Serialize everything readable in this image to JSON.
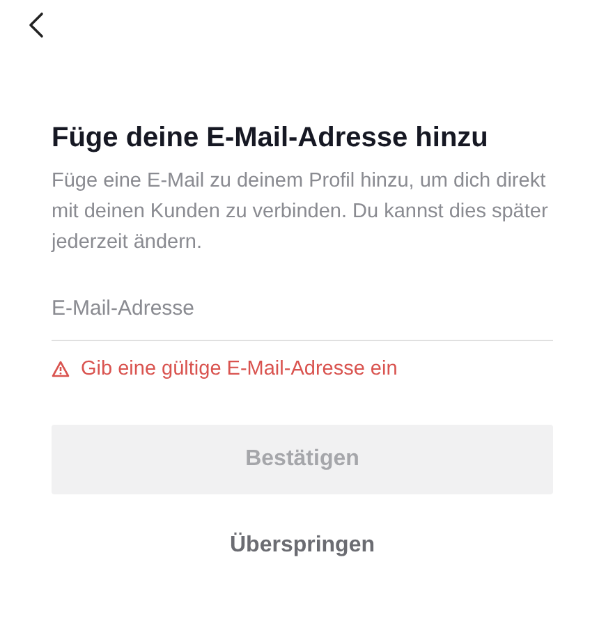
{
  "title": "Füge deine E-Mail-Adresse hinzu",
  "description": "Füge eine E-Mail zu deinem Profil hinzu, um dich direkt mit deinen Kunden zu verbinden. Du kannst dies später jederzeit ändern.",
  "email_field": {
    "placeholder": "E-Mail-Adresse"
  },
  "error": "Gib eine gültige E-Mail-Adresse ein",
  "confirm_button": {
    "label": "Bestätigen",
    "disabled": true
  },
  "skip_link": "Überspringen"
}
